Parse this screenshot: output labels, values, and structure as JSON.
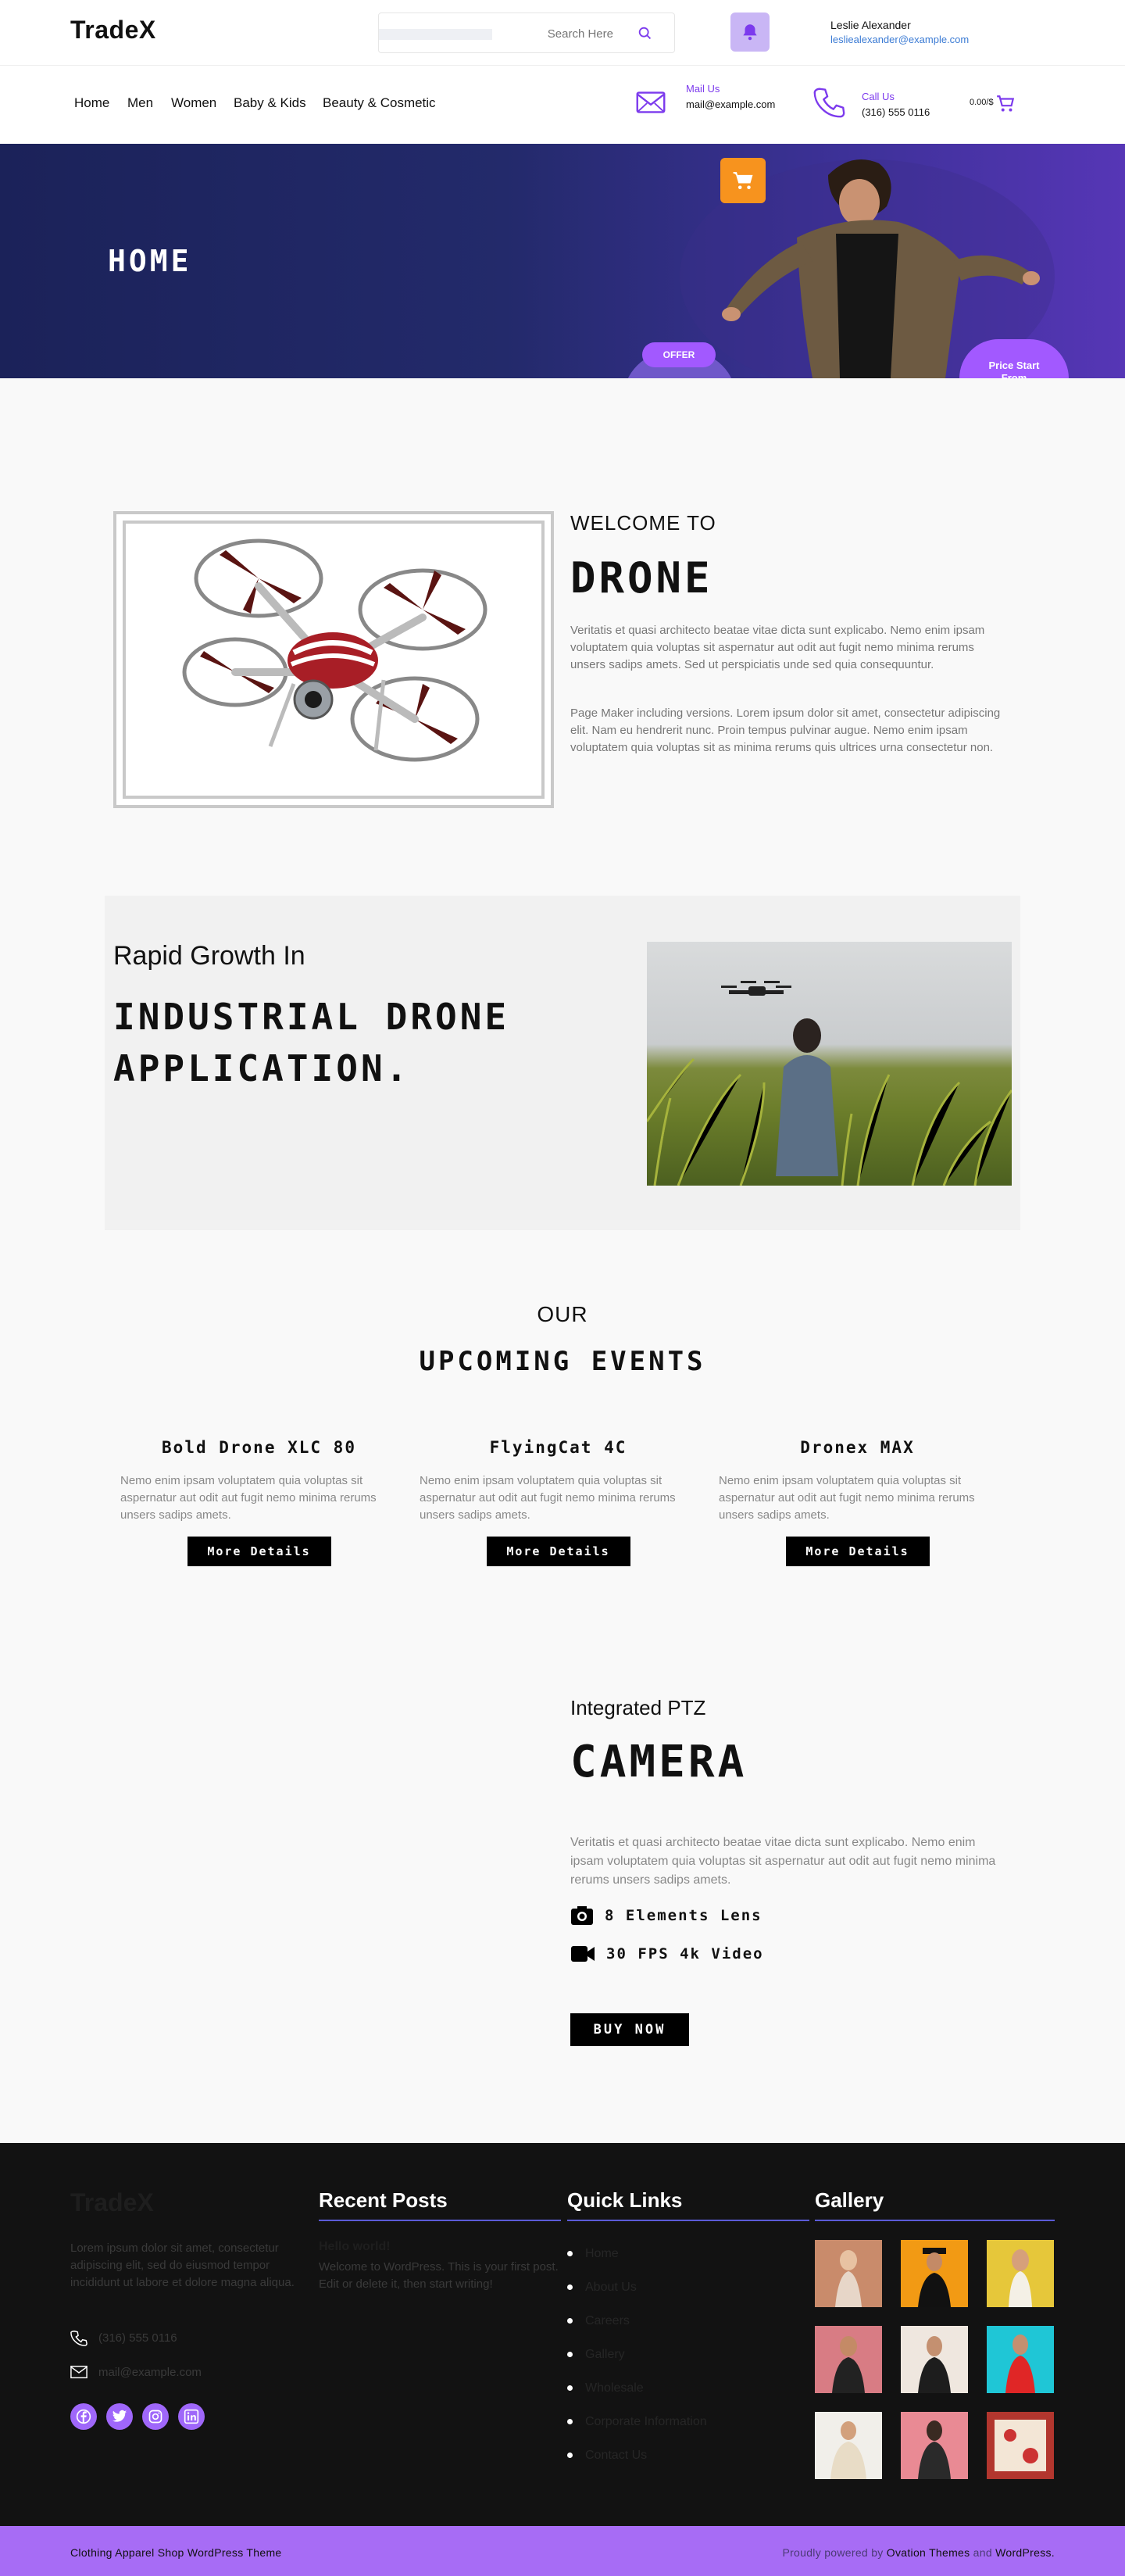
{
  "header": {
    "logo": "TradeX",
    "search_placeholder": "Search Here",
    "user_name": "Leslie Alexander",
    "user_email": "lesliealexander@example.com"
  },
  "nav": {
    "links": [
      "Home",
      "Men",
      "Women",
      "Baby & Kids",
      "Beauty & Cosmetic"
    ],
    "mail_label": "Mail Us",
    "mail_value": "mail@example.com",
    "call_label": "Call Us",
    "call_value": "(316) 555 0116",
    "cart_text": "0.00/$"
  },
  "hero": {
    "title": "HOME",
    "offer": "OFFER",
    "price_line1": "Price Start",
    "price_line2": "From"
  },
  "welcome": {
    "subtitle": "WELCOME TO",
    "title": "DRONE",
    "paragraph1": "Veritatis et quasi architecto beatae vitae dicta sunt explicabo. Nemo enim ipsam voluptatem quia voluptas sit aspernatur aut odit aut fugit nemo minima rerums unsers sadips amets. Sed ut perspiciatis unde sed quia consequuntur.",
    "paragraph2": "Page Maker including versions. Lorem ipsum dolor sit amet, consectetur adipiscing elit. Nam eu hendrerit nunc. Proin tempus pulvinar augue. Nemo enim ipsam voluptatem quia voluptas sit as minima rerums quis ultrices urna consectetur non."
  },
  "rapid": {
    "subtitle": "Rapid Growth In",
    "title": "INDUSTRIAL DRONE APPLICATION."
  },
  "events": {
    "subtitle": "OUR",
    "title": "UPCOMING EVENTS",
    "items": [
      {
        "name": "Bold Drone XLC 80",
        "text": "Nemo enim ipsam voluptatem quia voluptas sit aspernatur aut odit aut fugit nemo minima rerums unsers sadips amets.",
        "button": "More Details"
      },
      {
        "name": "FlyingCat 4C",
        "text": "Nemo enim ipsam voluptatem quia voluptas sit aspernatur aut odit aut fugit nemo minima rerums unsers sadips amets.",
        "button": "More Details"
      },
      {
        "name": "Dronex MAX",
        "text": "Nemo enim ipsam voluptatem quia voluptas sit aspernatur aut odit aut fugit nemo minima rerums unsers sadips amets.",
        "button": "More Details"
      }
    ]
  },
  "camera": {
    "subtitle": "Integrated PTZ",
    "title": "CAMERA",
    "paragraph": "Veritatis et quasi architecto beatae vitae dicta sunt explicabo. Nemo enim ipsam voluptatem quia voluptas sit aspernatur aut odit aut fugit nemo minima rerums unsers sadips amets.",
    "feature1": "8 Elements Lens",
    "feature2": "30 FPS 4k Video",
    "buy": "BUY NOW"
  },
  "footer": {
    "logo": "TradeX",
    "about": "Lorem ipsum dolor sit amet, consectetur adipiscing elit, sed do eiusmod tempor incididunt ut labore et dolore magna aliqua.",
    "phone": "(316) 555 0116",
    "email": "mail@example.com",
    "recent_heading": "Recent Posts",
    "post_title": "Hello world!",
    "post_text": "Welcome to WordPress. This is your first post. Edit or delete it, then start writing!",
    "links_heading": "Quick Links",
    "links": [
      "Home",
      "About Us",
      "Careers",
      "Gallery",
      "Wholesale",
      "Corporate Information",
      "Contact Us"
    ],
    "gallery_heading": "Gallery"
  },
  "bottom": {
    "left": "Clothing Apparel Shop WordPress Theme",
    "right_prefix": "Proudly powered by",
    "right_brand": "Ovation Themes",
    "right_and": "and",
    "right_wp": "WordPress."
  },
  "colors": {
    "accent": "#7c3aed",
    "social": "#9f67fa",
    "bottom_bar": "#a76cf5",
    "cart_orange": "#f7931e",
    "footer_bg": "#121212"
  }
}
